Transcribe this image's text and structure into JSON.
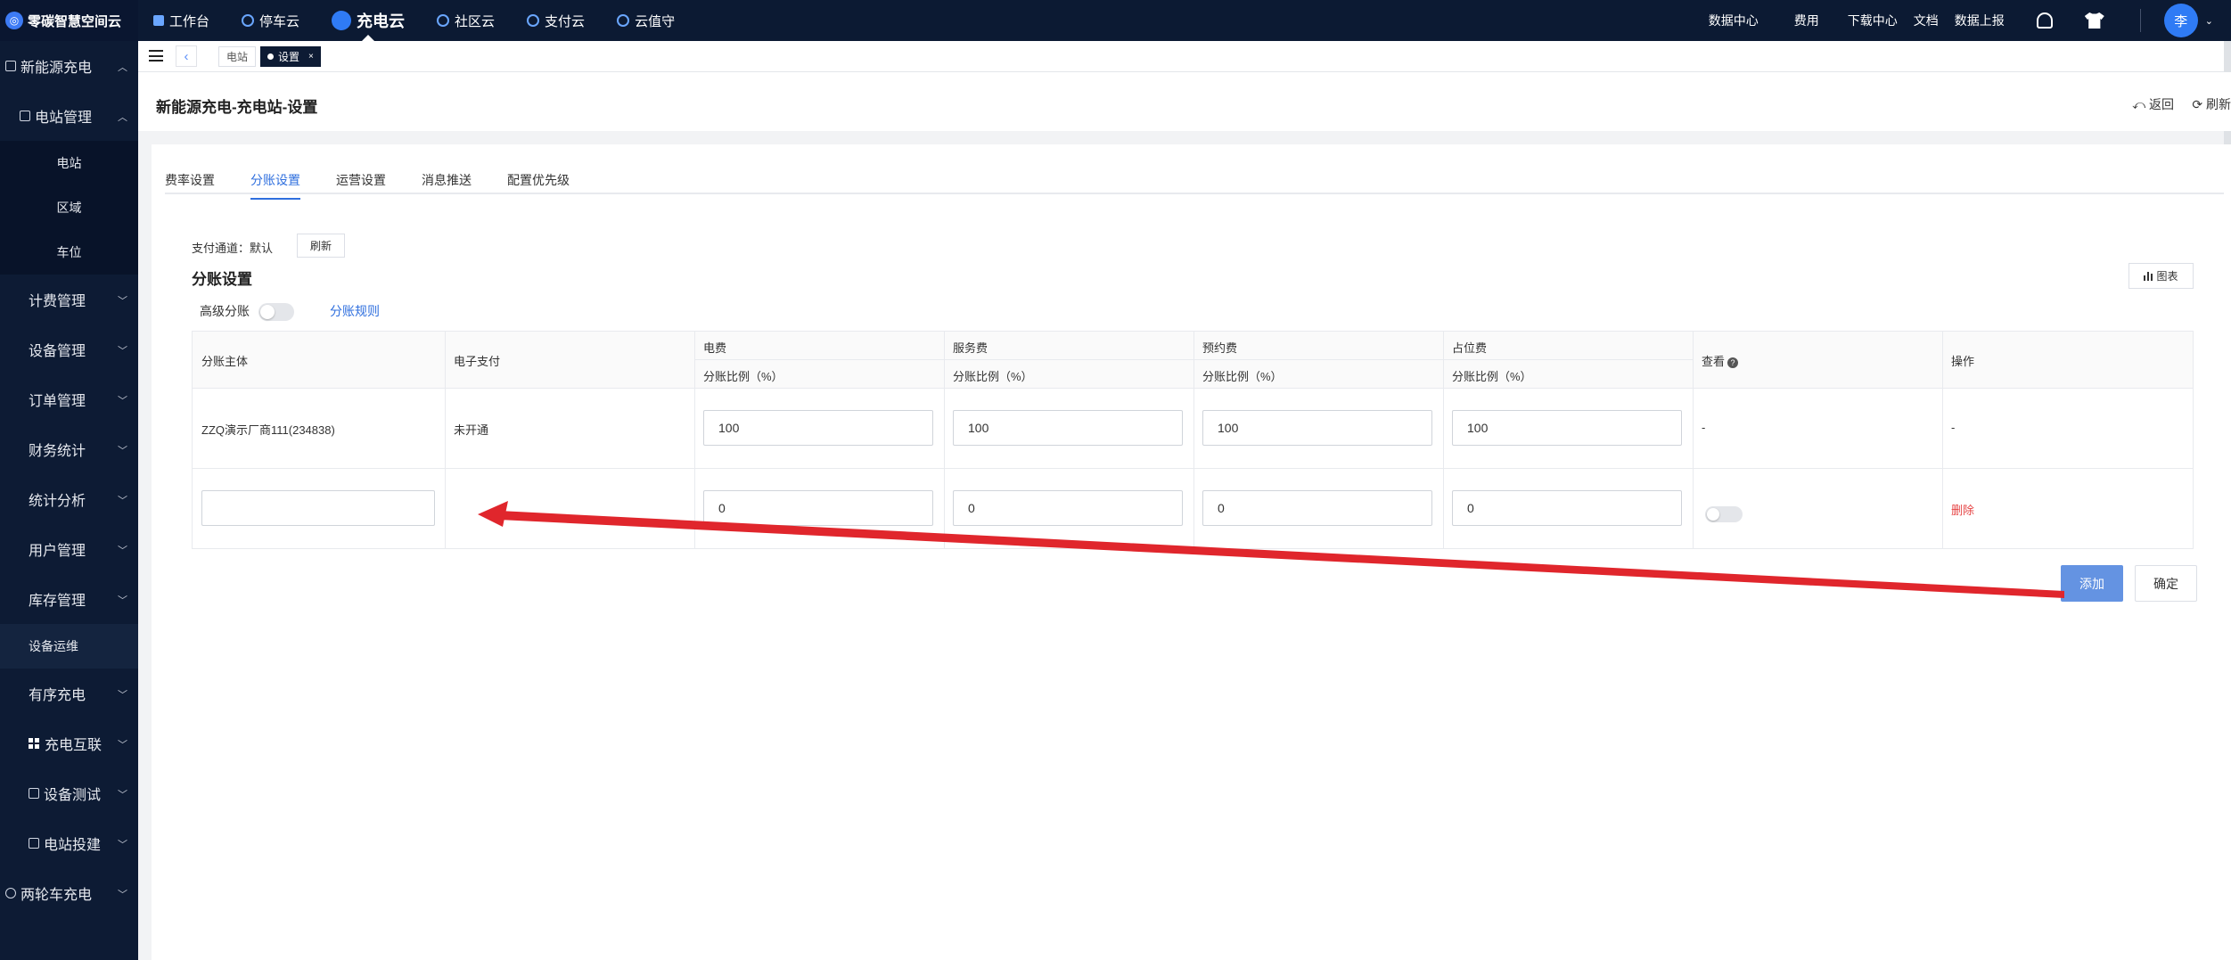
{
  "app": {
    "logo": "零碳智慧空间云",
    "logo_icon": "cloud-logo-icon"
  },
  "topnav": [
    {
      "label": "工作台",
      "icon": "dashboard-icon"
    },
    {
      "label": "停车云",
      "icon": "parking-icon"
    },
    {
      "label": "充电云",
      "icon": "charging-icon",
      "active": true
    },
    {
      "label": "社区云",
      "icon": "community-icon"
    },
    {
      "label": "支付云",
      "icon": "payment-icon"
    },
    {
      "label": "云值守",
      "icon": "guard-icon"
    }
  ],
  "topright": {
    "data_center": "数据中心",
    "fees": "费用",
    "downloads": "下载中心",
    "docs": "文档",
    "data_report": "数据上报",
    "avatar": "李"
  },
  "sidebar": {
    "root": "新能源充电",
    "station_mgmt": "电站管理",
    "leaves": [
      "电站",
      "区域",
      "车位"
    ],
    "items": [
      "计费管理",
      "设备管理",
      "订单管理",
      "财务统计",
      "统计分析",
      "用户管理",
      "库存管理"
    ],
    "ops": "设备运维",
    "ordered": "有序充电",
    "interconnect": "充电互联",
    "testing": "设备测试",
    "build": "电站投建",
    "two_wheel": "两轮车充电"
  },
  "pagetabs": {
    "tab1": "电站",
    "tab2": "设置"
  },
  "header": {
    "title": "新能源充电-充电站-设置",
    "back": "返回",
    "refresh": "刷新"
  },
  "tabs": [
    "费率设置",
    "分账设置",
    "运营设置",
    "消息推送",
    "配置优先级"
  ],
  "split": {
    "pay_label": "支付通道：默认",
    "refresh_btn": "刷新",
    "section_title": "分账设置",
    "chart_btn": "图表",
    "advanced_label": "高级分账",
    "advanced_on": false,
    "rules_link": "分账规则",
    "columns": {
      "subject": "分账主体",
      "epay": "电子支付",
      "electricity": "电费",
      "service": "服务费",
      "reservation": "预约费",
      "occupancy": "占位费",
      "ratio": "分账比例（%）",
      "view": "查看",
      "action": "操作"
    },
    "rows": [
      {
        "subject": "ZZQ演示厂商111(234838)",
        "epay": "未开通",
        "electricity": "100",
        "service": "100",
        "reservation": "100",
        "occupancy": "100",
        "view": "-",
        "action": "-"
      },
      {
        "subject": "",
        "epay": "",
        "electricity": "0",
        "service": "0",
        "reservation": "0",
        "occupancy": "0",
        "view_toggle": false,
        "action": "删除"
      }
    ],
    "add_btn": "添加",
    "confirm_btn": "确定"
  },
  "colors": {
    "nav_bg": "#0c1a33",
    "accent": "#2f6fde",
    "add_btn": "#6493e2",
    "delete": "#e64545",
    "arrow": "#e0262c"
  }
}
